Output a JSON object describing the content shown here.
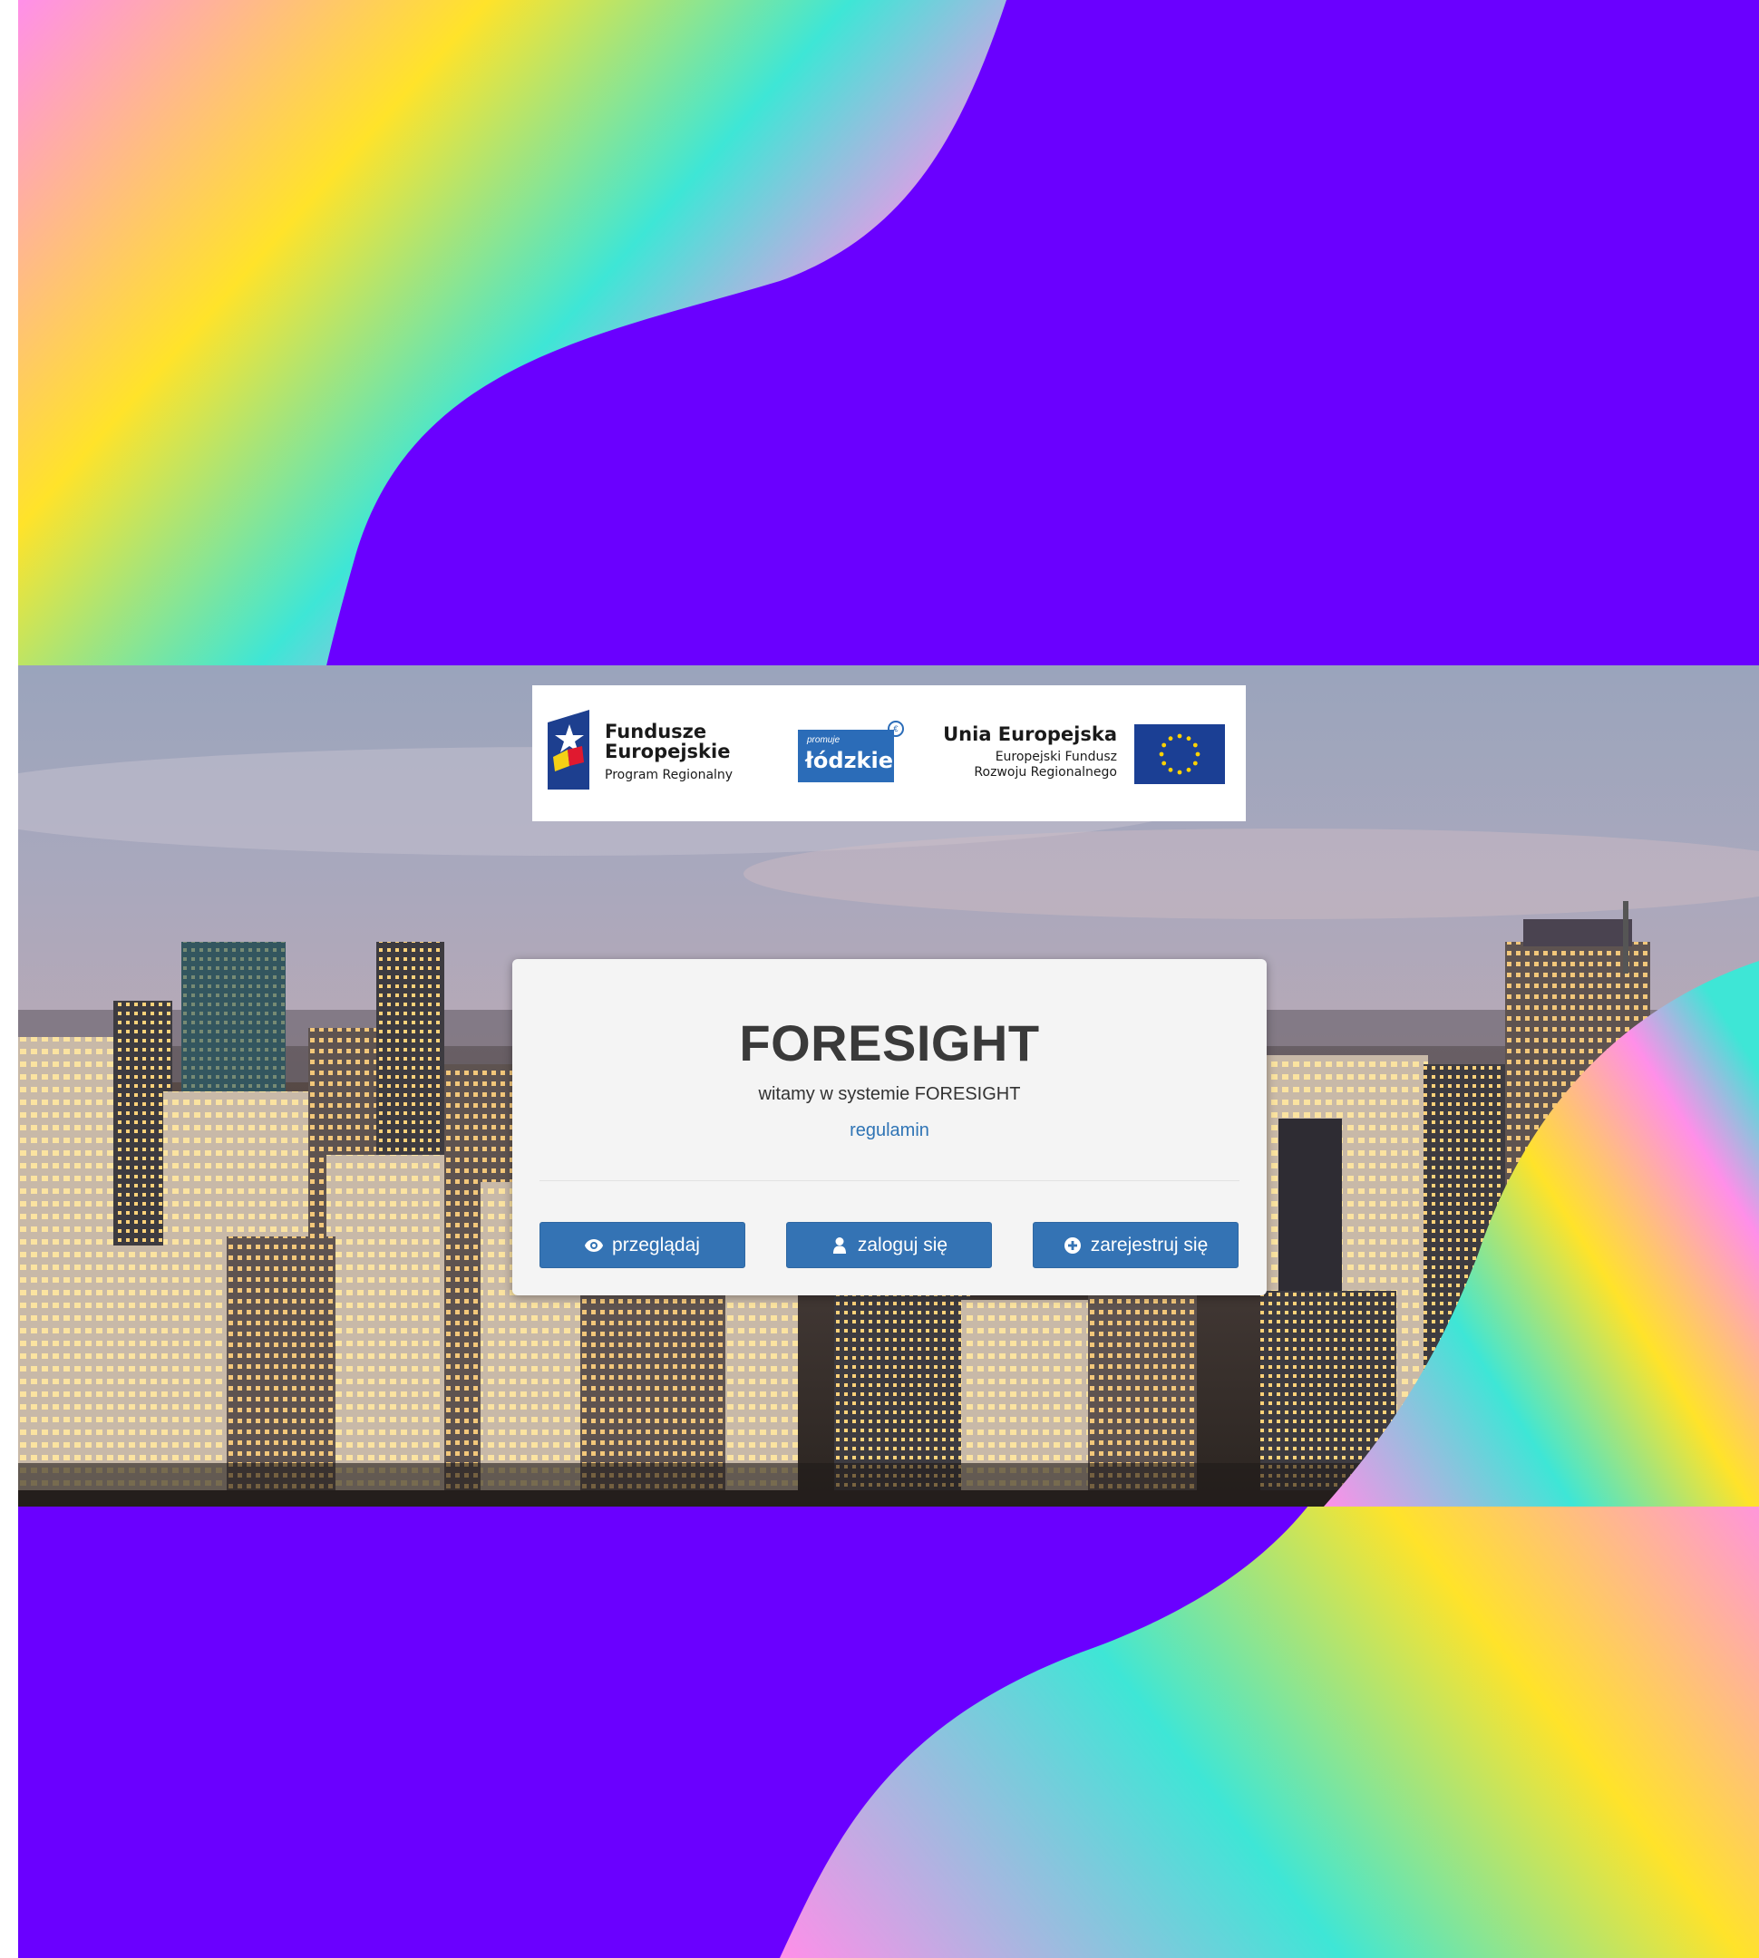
{
  "colors": {
    "background": "#6a00ff",
    "wave_stops": [
      "#ff8fe9",
      "#ffe32a",
      "#3ee6d6"
    ],
    "button": "#3473b4",
    "link": "#2f74b5",
    "card": "#f4f4f4"
  },
  "logos": {
    "fundusze": {
      "icon": "fundusze-europejskie-star-icon",
      "line1": "Fundusze",
      "line2": "Europejskie",
      "line3": "Program Regionalny"
    },
    "lodzkie": {
      "icon": "lodzkie-logo-icon",
      "small": "promuje",
      "main": "łódzkie"
    },
    "eu": {
      "icon": "eu-flag-icon",
      "line1": "Unia Europejska",
      "line2": "Europejski Fundusz",
      "line3": "Rozwoju Regionalnego"
    }
  },
  "card": {
    "title": "FORESIGHT",
    "subtitle": "witamy w systemie FORESIGHT",
    "link": "regulamin",
    "buttons": {
      "browse": {
        "label": "przeglądaj",
        "icon": "eye-icon"
      },
      "login": {
        "label": "zaloguj się",
        "icon": "user-icon"
      },
      "register": {
        "label": "zarejestruj się",
        "icon": "plus-circle-icon"
      }
    }
  }
}
